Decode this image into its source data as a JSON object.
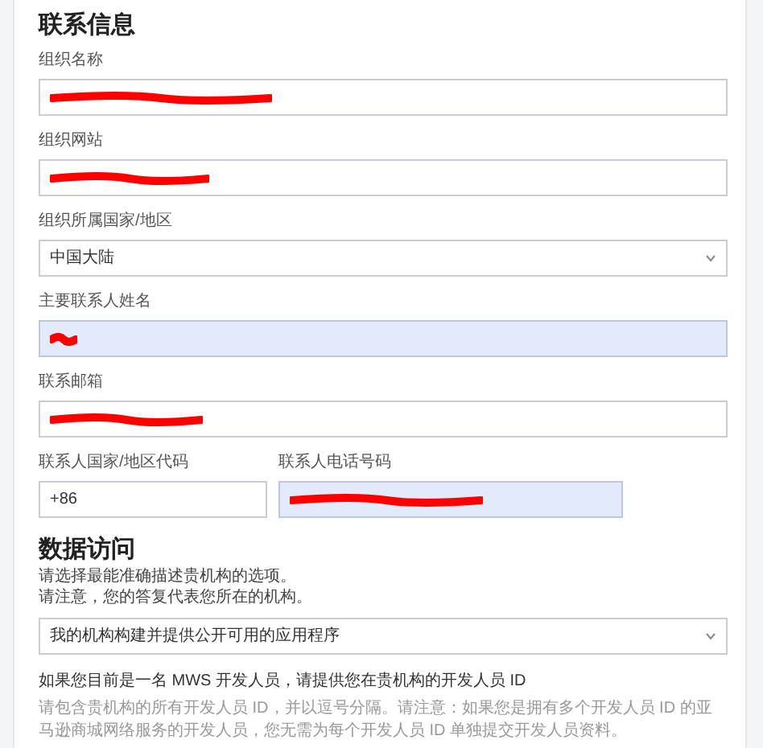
{
  "sections": [
    {
      "title": "联系信息",
      "fields": [
        {
          "kind": "text",
          "label": "组织名称",
          "redacted": true,
          "autofilled": false
        },
        {
          "kind": "text",
          "label": "组织网站",
          "redacted": true,
          "autofilled": false
        },
        {
          "kind": "select",
          "label": "组织所属国家/地区",
          "value": "中国大陆",
          "redacted": false,
          "autofilled": false
        },
        {
          "kind": "text",
          "label": "主要联系人姓名",
          "redacted": true,
          "autofilled": true
        },
        {
          "kind": "text",
          "label": "联系邮箱",
          "redacted": true,
          "autofilled": false
        },
        {
          "kind": "pair",
          "items": [
            {
              "label": "联系人国家/地区代码",
              "value": "+86",
              "redacted": false,
              "autofilled": false
            },
            {
              "label": "联系人电话号码",
              "redacted": true,
              "autofilled": true
            }
          ]
        }
      ]
    },
    {
      "title": "数据访问",
      "notes": [
        "请选择最能准确描述贵机构的选项。",
        "请注意，您的答复代表您所在的机构。"
      ],
      "fields": [
        {
          "kind": "select",
          "value": "我的机构构建并提供公开可用的应用程序",
          "redacted": false,
          "autofilled": false
        },
        {
          "kind": "question",
          "label": "如果您目前是一名 MWS 开发人员，请提供您在贵机构的开发人员 ID",
          "hint": "请包含贵机构的所有开发人员 ID，并以逗号分隔。请注意：如果您是拥有多个开发人员 ID 的亚马逊商城网络服务的开发人员，您无需为每个开发人员 ID 单独提交开发人员资料。"
        }
      ]
    }
  ]
}
